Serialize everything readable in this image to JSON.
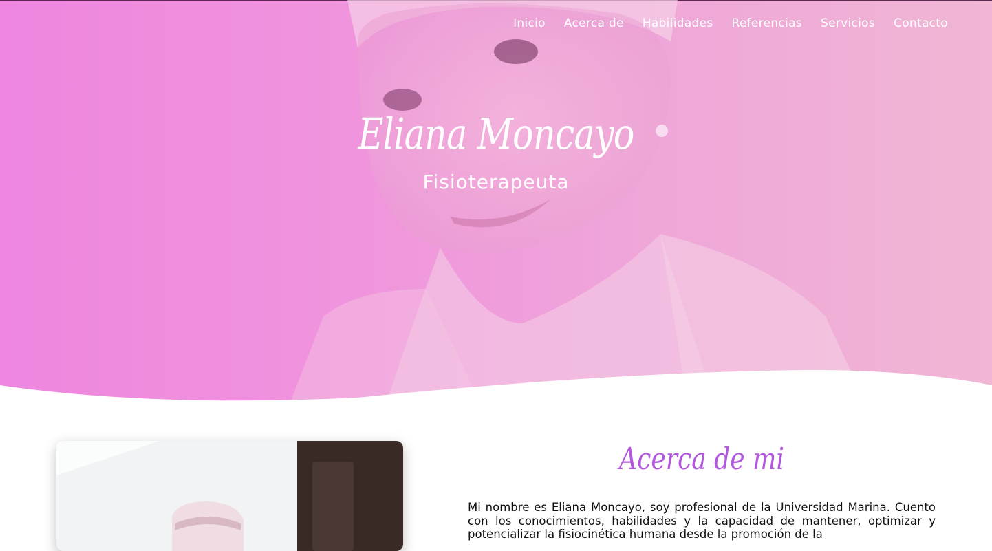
{
  "nav": {
    "items": [
      {
        "label": "Inicio"
      },
      {
        "label": "Acerca de"
      },
      {
        "label": "Habilidades"
      },
      {
        "label": "Referencias"
      },
      {
        "label": "Servicios"
      },
      {
        "label": "Contacto"
      }
    ]
  },
  "hero": {
    "name": "Eliana Moncayo",
    "profession": "Fisioterapeuta"
  },
  "about": {
    "heading": "Acerca de mi",
    "paragraph": "Mi nombre es Eliana Moncayo, soy profesional de la Universidad Marina. Cuento con los conocimientos, habilidades y la capacidad de mantener, optimizar y potencializar la fisiocinética humana desde la promoción de la"
  },
  "colors": {
    "hero_pink": "#ee86df",
    "accent_purple": "#b356e0",
    "white": "#ffffff"
  }
}
